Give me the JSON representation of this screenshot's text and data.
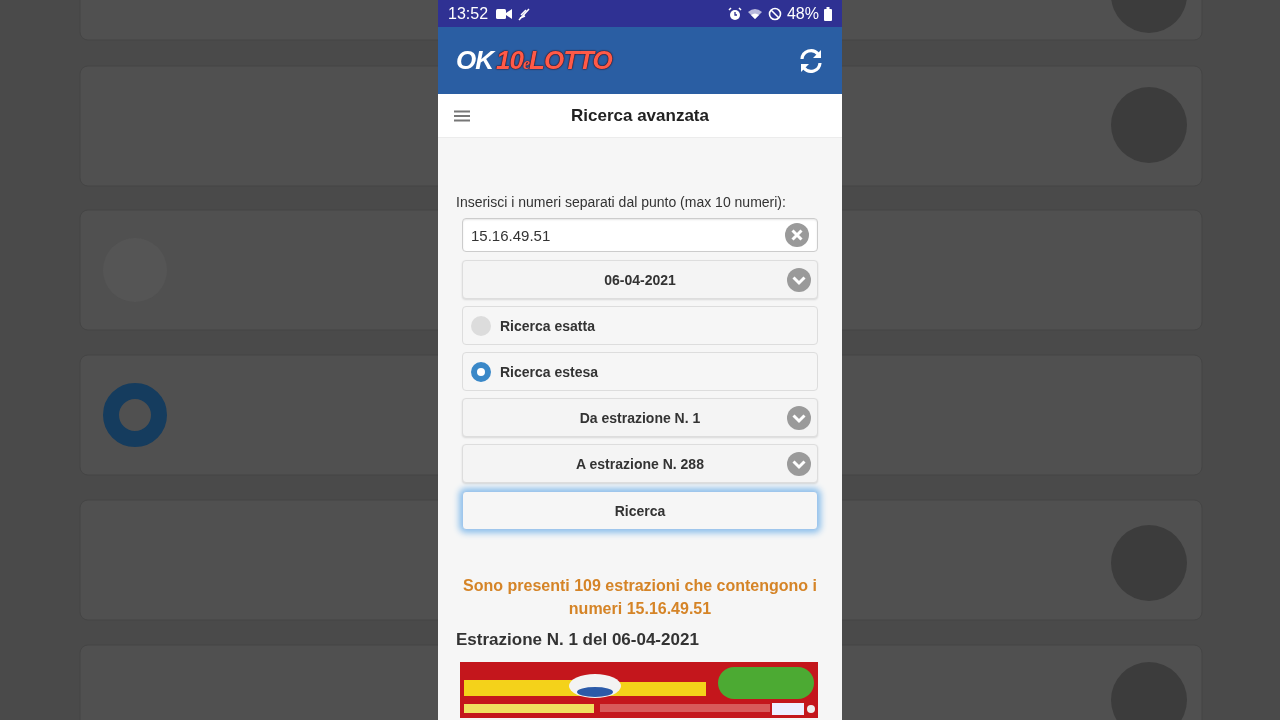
{
  "status_bar": {
    "time": "13:52",
    "battery": "48%"
  },
  "header": {
    "logo": {
      "ok": "OK",
      "ten": "10",
      "e": "e",
      "lotto": "LOTTO"
    }
  },
  "title_bar": {
    "title": "Ricerca avanzata"
  },
  "form": {
    "label": "Inserisci i numeri separati dal punto (max 10 numeri):",
    "numbers": {
      "value": "15.16.49.51"
    },
    "date_select": {
      "value": "06-04-2021"
    },
    "search_modes": [
      {
        "label": "Ricerca esatta",
        "selected": false
      },
      {
        "label": "Ricerca estesa",
        "selected": true
      }
    ],
    "from_select": {
      "value": "Da estrazione N. 1"
    },
    "to_select": {
      "value": "A estrazione N. 288"
    },
    "search_button": {
      "label": "Ricerca",
      "focused": true
    }
  },
  "result": {
    "message": "Sono presenti 109 estrazioni che contengono i numeri 15.16.49.51",
    "first_heading": "Estrazione N. 1 del 06-04-2021"
  }
}
